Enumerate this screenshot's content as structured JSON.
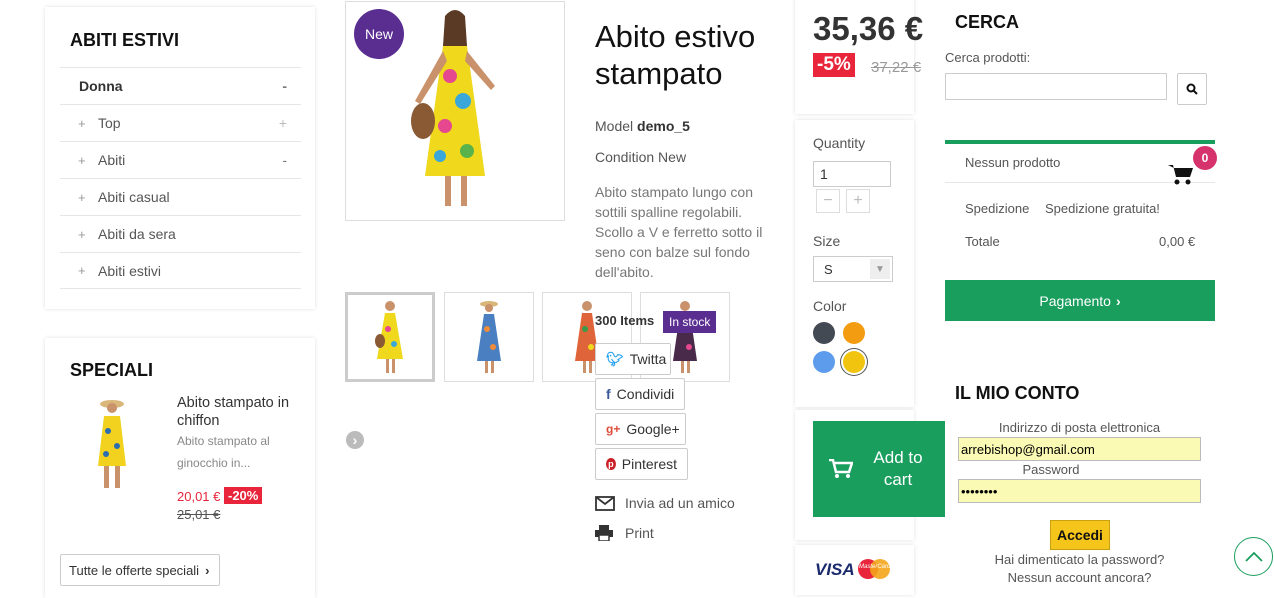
{
  "categories": {
    "title": "ABITI ESTIVI",
    "top": {
      "label": "Donna",
      "toggle": "-"
    },
    "items": [
      {
        "label": "Top",
        "toggle": "+"
      },
      {
        "label": "Abiti",
        "toggle": "-"
      },
      {
        "label": "Abiti casual",
        "toggle": ""
      },
      {
        "label": "Abiti da sera",
        "toggle": ""
      },
      {
        "label": "Abiti estivi",
        "toggle": ""
      }
    ],
    "plus_glyph": "+"
  },
  "specials": {
    "title": "SPECIALI",
    "product_name": "Abito stampato in chiffon",
    "description": "Abito stampato al ginocchio in...",
    "price": "20,01 €",
    "discount": "-20%",
    "old_price": "25,01 €",
    "all_link": "Tutte le offerte speciali"
  },
  "product": {
    "badge": "New",
    "title": "Abito estivo stampato",
    "model_label": "Model",
    "model_value": "demo_5",
    "condition_label": "Condition",
    "condition_value": "New",
    "description": "Abito stampato lungo con sottili spalline regolabili. Scollo a V e ferretto sotto il seno con balze sul fondo dell'abito.",
    "stock_count": "300 Items",
    "stock_status": "In stock",
    "share": {
      "twitter": "Twitta",
      "facebook": "Condividi",
      "google": "Google+",
      "pinterest": "Pinterest"
    },
    "send_friend": "Invia ad un amico",
    "print": "Print"
  },
  "price_box": {
    "price": "35,36 €",
    "discount": "-5%",
    "old_price": "37,22 €"
  },
  "options": {
    "quantity_label": "Quantity",
    "quantity_value": "1",
    "minus": "−",
    "plus": "+",
    "size_label": "Size",
    "size_value": "S",
    "color_label": "Color",
    "colors": [
      "#434a54",
      "#f39c11",
      "#5d9cec",
      "#f1c40f"
    ],
    "add_to_cart": "Add to cart",
    "payment_logos": {
      "visa": "VISA",
      "mastercard": "MasterCard"
    }
  },
  "search": {
    "title": "CERCA",
    "label": "Cerca prodotti:",
    "placeholder": ""
  },
  "cart": {
    "empty": "Nessun prodotto",
    "count": "0",
    "shipping_label": "Spedizione",
    "shipping_value": "Spedizione gratuita!",
    "total_label": "Totale",
    "total_value": "0,00 €",
    "checkout": "Pagamento",
    "accent": "#1a9e5e"
  },
  "account": {
    "title": "IL MIO CONTO",
    "email_label": "Indirizzo di posta elettronica",
    "email_value": "arrebishop@gmail.com",
    "password_label": "Password",
    "password_value": "••••••••",
    "login": "Accedi",
    "forgot": "Hai dimenticato la password?",
    "no_account": "Nessun account ancora?"
  },
  "colors": {
    "purple": "#5a2d91",
    "green": "#1a9e5e",
    "red": "#e8253a",
    "yellow": "#f5c51b"
  }
}
